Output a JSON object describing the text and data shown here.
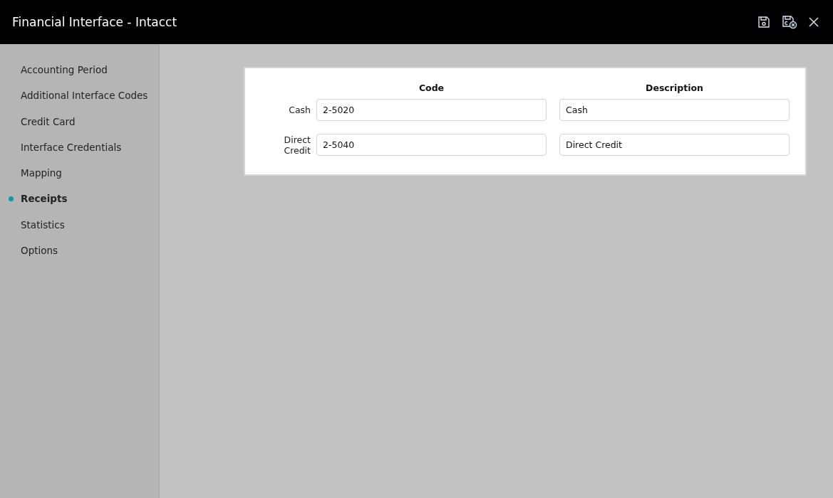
{
  "window": {
    "title": "Financial Interface - Intacct"
  },
  "sidebar": {
    "items": [
      {
        "label": "Accounting Period",
        "selected": false
      },
      {
        "label": "Additional Interface Codes",
        "selected": false
      },
      {
        "label": "Credit Card",
        "selected": false
      },
      {
        "label": "Interface Credentials",
        "selected": false
      },
      {
        "label": "Mapping",
        "selected": false
      },
      {
        "label": "Receipts",
        "selected": true
      },
      {
        "label": "Statistics",
        "selected": false
      },
      {
        "label": "Options",
        "selected": false
      }
    ]
  },
  "table": {
    "columns": [
      "Code",
      "Description"
    ],
    "rows": [
      {
        "label": "Cash",
        "code": "2-5020",
        "description": "Cash"
      },
      {
        "label": "Direct Credit",
        "code": "2-5040",
        "description": "Direct Credit"
      }
    ]
  }
}
